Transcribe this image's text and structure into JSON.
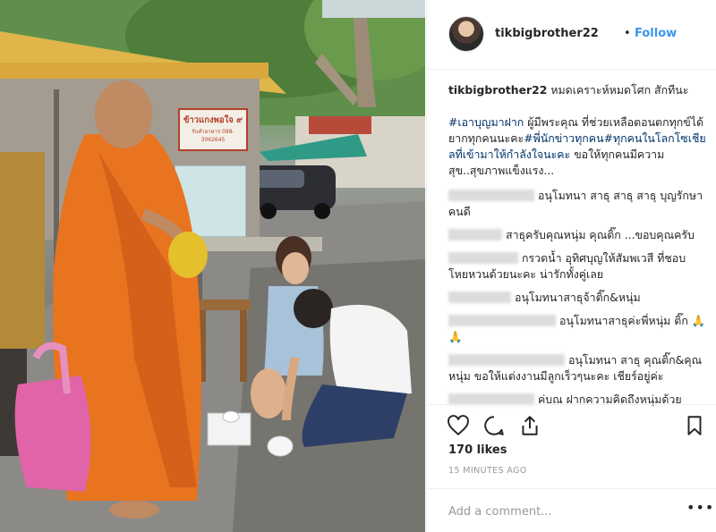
{
  "photo": {
    "sign_line1": "ข้าวแกงพอใจ ๙",
    "sign_line2": "รับทำอาหาร 098-3062645"
  },
  "header": {
    "username": "tikbigbrother22",
    "separator": "•",
    "follow_label": "Follow"
  },
  "caption": {
    "username": "tikbigbrother22",
    "line1": "หมดเคราะห์หมดโศก สักทีนะ",
    "tag1": "#เอาบุญมาฝาก",
    "text1": " ผู้มีพระคุณ ที่ช่วยเหลือตอนตกทุกข์ได้ยากทุกคนนะคะ",
    "tag2": "#พี่นักข่าวทุกคน",
    "tag3": "#ทุกคนในโลกโซเชียลที่เข้ามาให้กำลังใจนะคะ",
    "text2": " ขอให้ทุกคนมีความสุข..สุขภาพแข็งแรง..."
  },
  "comments": [
    {
      "text": "อนุโมทนา สาธุ สาธุ สาธุ บุญรักษาคนดี"
    },
    {
      "text": "สาธุครับคุณหนุ่ม คุณติ๊ก ...ขอบคุณครับ"
    },
    {
      "text": "กรวดน้ำ อุทิศบุญให้สัมพเวสี ที่ชอบโหยหวนด้วยนะคะ น่ารักทั้งคู่เลย"
    },
    {
      "text": "อนุโมทนาสาธุจ้าติ๊ก&หนุ่ม"
    },
    {
      "text": "อนุโมทนาสาธุค่ะพี่หนุ่ม ติ๊ก 🙏🙏"
    },
    {
      "text": "อนุโมทนา สาธุ คุณติ๊ก&คุณหนุ่ม ขอให้แต่งงานมีลูกเร็วๆนะคะ เชียร์อยู่ค่ะ"
    },
    {
      "text": "ค่บณ ฝากความคิดถึงหนุ่มด้วย"
    }
  ],
  "icons": {
    "like": "heart-icon",
    "comment": "comment-icon",
    "share": "share-icon",
    "save": "bookmark-icon",
    "more": "more-icon"
  },
  "likes_label": "170 likes",
  "timestamp": "15 MINUTES AGO",
  "add_comment_placeholder": "Add a comment...",
  "more_label": "•••",
  "colors": {
    "link": "#3897f0",
    "hashtag": "#003569",
    "robe": "#e8741f"
  }
}
